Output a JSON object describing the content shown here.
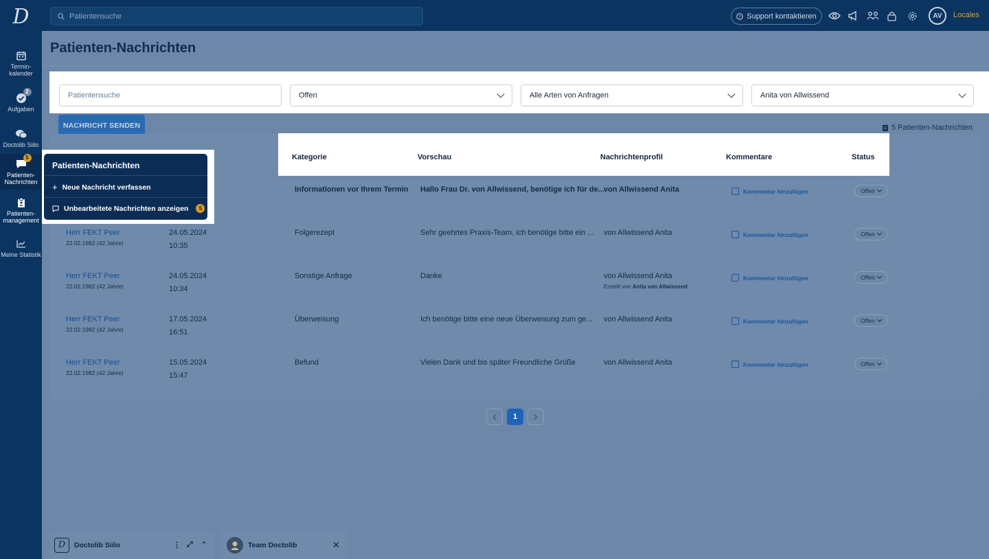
{
  "logo_letter": "D",
  "sidebar": {
    "items": [
      {
        "label": "Termin-\nkalender",
        "icon": "calendar-icon"
      },
      {
        "label": "Aufgaben",
        "icon": "check-icon",
        "badge": "2"
      },
      {
        "label": "Doctolib Siilo",
        "icon": "chat-bubbles-icon"
      },
      {
        "label": "Patienten-\nNachrichten",
        "icon": "message-icon",
        "badge": "5"
      },
      {
        "label": "Patienten-\nmanagement",
        "icon": "clipboard-icon"
      },
      {
        "label": "Meine Statistik",
        "icon": "chart-icon"
      }
    ]
  },
  "topbar": {
    "search_placeholder": "Patientensuche",
    "support_label": "Support kontaktieren",
    "avatar_initials": "AV",
    "locales_label": "Locales"
  },
  "page": {
    "title": "Patienten-Nachrichten",
    "send_button": "NACHRICHT SENDEN",
    "count_label": "5 Patienten-Nachrichten"
  },
  "filters": {
    "search_placeholder": "Patientensuche",
    "status_value": "Offen",
    "type_value": "Alle Arten von Anfragen",
    "profile_value": "Anita von Allwissend"
  },
  "table": {
    "headers": {
      "category": "Kategorie",
      "preview": "Vorschau",
      "profile": "Nachrichtenprofil",
      "comments": "Kommentare",
      "status": "Status"
    },
    "rows": [
      {
        "name": "",
        "dob": "",
        "date": "",
        "time": "",
        "category": "Informationen vor Ihrem Termin",
        "preview": "Hallo Frau Dr. von Allwissend, benötige ich für de...",
        "profile": "von Allwissend Anita",
        "comment": "Kommentar hinzufügen",
        "status": "Offen",
        "bold": true
      },
      {
        "name": "Herr FEKT Peer",
        "dob": "22.02.1982 (42 Jahre)",
        "date": "24.05.2024",
        "time": "10:35",
        "category": "Folgerezept",
        "preview": "Sehr geehrtes Praxis-Team, ich benötige bitte ein ...",
        "profile": "von Allwissend Anita",
        "comment": "Kommentar hinzufügen",
        "status": "Offen"
      },
      {
        "name": "Herr FEKT Peer",
        "dob": "22.02.1982 (42 Jahre)",
        "date": "24.05.2024",
        "time": "10:34",
        "category": "Sonstige Anfrage",
        "preview": "Danke",
        "profile": "von Allwissend Anita",
        "created_prefix": "Erstellt von",
        "created_by": "Anita von Allwissend",
        "comment": "Kommentar hinzufügen",
        "status": "Offen"
      },
      {
        "name": "Herr FEKT Peer",
        "dob": "22.02.1982 (42 Jahre)",
        "date": "17.05.2024",
        "time": "16:51",
        "category": "Überweisung",
        "preview": "Ich benötige bitte eine neue Überweisung zum ge...",
        "profile": "von Allwissend Anita",
        "comment": "Kommentar hinzufügen",
        "status": "Offen"
      },
      {
        "name": "Herr FEKT Peer",
        "dob": "22.02.1982 (42 Jahre)",
        "date": "15.05.2024",
        "time": "15:47",
        "category": "Befund",
        "preview": "Vielen Dank und bis später Freundliche Grüße",
        "profile": "von Allwissend Anita",
        "comment": "Kommentar hinzufügen",
        "status": "Offen"
      }
    ]
  },
  "pagination": {
    "current": "1"
  },
  "popover": {
    "title": "Patienten-Nachrichten",
    "item_new": "Neue Nachricht verfassen",
    "item_unread": "Unbearbeitete Nachrichten anzeigen",
    "unread_badge": "5"
  },
  "chat_tabs": {
    "siilo_label": "Doctolib Siilo",
    "team_label": "Team Doctolib"
  },
  "colors": {
    "navy": "#0b3460",
    "overlay": "#6c87a8",
    "accent_blue": "#1e64b8",
    "badge_amber": "#d39a2a"
  }
}
